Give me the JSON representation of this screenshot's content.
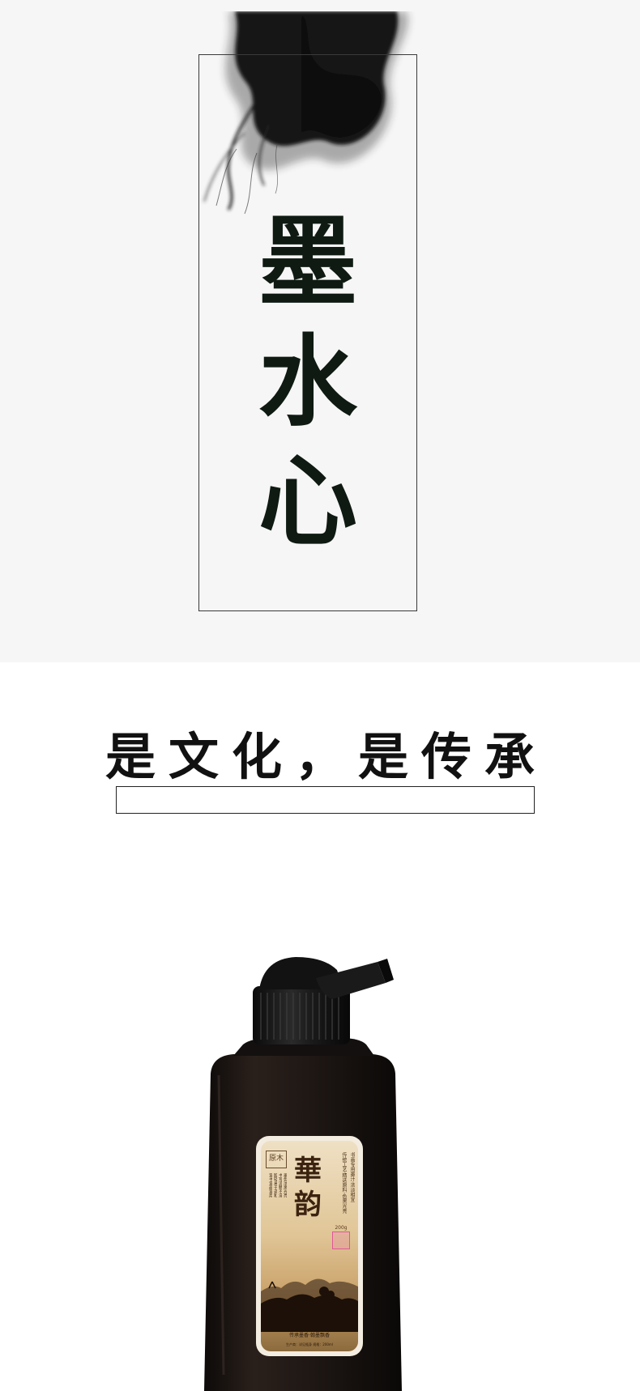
{
  "hero": {
    "title_chars": [
      "墨",
      "水",
      "心"
    ]
  },
  "slogan": {
    "chars": [
      "是",
      "文",
      "化",
      "，",
      "是",
      "传",
      "承"
    ]
  },
  "product_label": {
    "brand_seal": "原木",
    "name_chars": [
      "華",
      "韵"
    ],
    "side_text_1": "传统工艺·精选原料·色黑光亮",
    "side_text_2": "书画专用墨汁·浓淡相宜",
    "small_text_cols": [
      "墨色浓黑光亮",
      "书写流畅不滞",
      "胶轻易于调和",
      "宜书宜画宜用"
    ],
    "code": "200g",
    "tagline": "传承墨香·翰墨飘香",
    "footer": "生产商：详见瓶身  规格：200ml"
  },
  "colors": {
    "page_bg": "#f6f6f6",
    "lower_bg": "#ffffff",
    "title_color": "#0e1a12",
    "slogan_color": "#111111",
    "bottle_color": "#1e1714",
    "label_gold": "#e0c596"
  },
  "icons": [
    "ink-smoke-icon",
    "ink-bottle-icon",
    "landscape-icon"
  ]
}
